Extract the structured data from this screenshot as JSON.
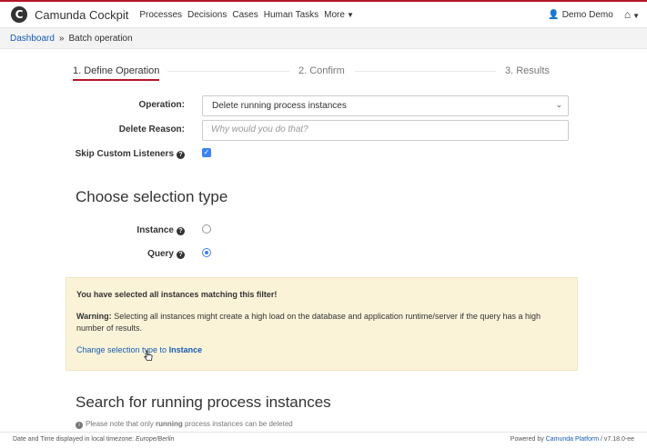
{
  "colors": {
    "brand": "#b5152b",
    "link": "#155cb5",
    "accent": "#3b82f6",
    "warning_bg": "#fbf3d8"
  },
  "navbar": {
    "logo_text": "C",
    "title": "Camunda Cockpit",
    "items": [
      "Processes",
      "Decisions",
      "Cases",
      "Human Tasks",
      "More"
    ],
    "user": "Demo Demo"
  },
  "breadcrumb": {
    "home": "Dashboard",
    "separator": "»",
    "current": "Batch operation"
  },
  "steps": [
    "1. Define Operation",
    "2. Confirm",
    "3. Results"
  ],
  "form": {
    "operation_label": "Operation:",
    "operation_value": "Delete running process instances",
    "reason_label": "Delete Reason:",
    "reason_placeholder": "Why would you do that?",
    "skip_label": "Skip Custom Listeners",
    "skip_checked": true
  },
  "selection": {
    "title": "Choose selection type",
    "instance_label": "Instance",
    "query_label": "Query",
    "selected": "Query"
  },
  "warning": {
    "heading": "You have selected all instances matching this filter!",
    "warn_label": "Warning:",
    "warn_text": "Selecting all instances might create a high load on the database and application runtime/server if the query has a high number of results.",
    "change_text": "Change selection type to",
    "change_target": "Instance"
  },
  "search": {
    "title": "Search for running process instances",
    "note_pre": "Please note that only",
    "note_bold": "running",
    "note_post": "process instances can be deleted"
  },
  "footer": {
    "left_text": "Date and Time displayed in local timezone:",
    "timezone": "Europe/Berlin",
    "powered_by": "Powered by",
    "platform": "Camunda Platform",
    "version": "/ v7.18.0-ee"
  }
}
